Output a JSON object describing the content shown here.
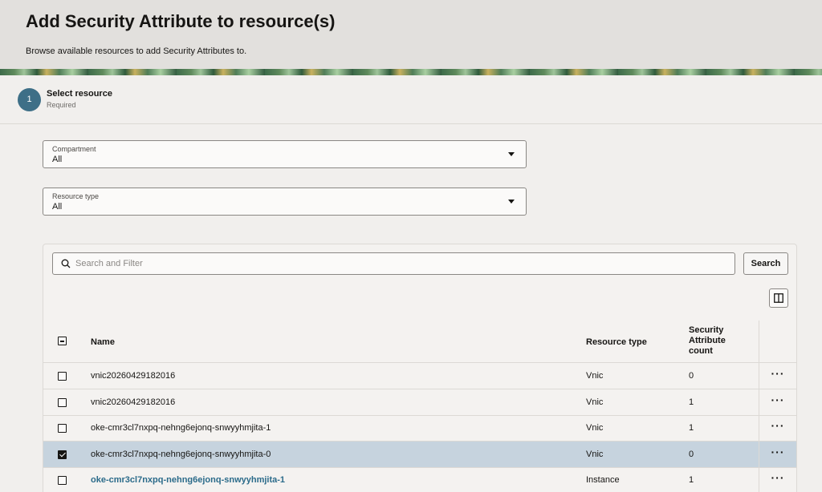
{
  "header": {
    "title": "Add Security Attribute to resource(s)",
    "subtitle": "Browse available resources to add Security Attributes to."
  },
  "step": {
    "number": "1",
    "title": "Select resource",
    "subtitle": "Required",
    "accent_color": "#3e6f87"
  },
  "compartment": {
    "label": "Compartment",
    "value": "All"
  },
  "resource_type": {
    "label": "Resource type",
    "value": "All"
  },
  "search": {
    "placeholder": "Search and Filter",
    "button_label": "Search"
  },
  "table": {
    "headers": {
      "name": "Name",
      "resource_type": "Resource type",
      "count_line1": "Security",
      "count_line2": "Attribute",
      "count_line3": "count"
    },
    "rows": [
      {
        "name": "vnic20260429182016",
        "type": "Vnic",
        "count": "0",
        "checked": false,
        "link": false
      },
      {
        "name": "vnic20260429182016",
        "type": "Vnic",
        "count": "1",
        "checked": false,
        "link": false
      },
      {
        "name": "oke-cmr3cl7nxpq-nehng6ejonq-snwyyhmjita-1",
        "type": "Vnic",
        "count": "1",
        "checked": false,
        "link": false
      },
      {
        "name": "oke-cmr3cl7nxpq-nehng6ejonq-snwyyhmjita-0",
        "type": "Vnic",
        "count": "0",
        "checked": true,
        "link": false
      },
      {
        "name": "oke-cmr3cl7nxpq-nehng6ejonq-snwyyhmjita-1",
        "type": "Instance",
        "count": "1",
        "checked": false,
        "link": true
      }
    ],
    "more_glyph": "···"
  }
}
